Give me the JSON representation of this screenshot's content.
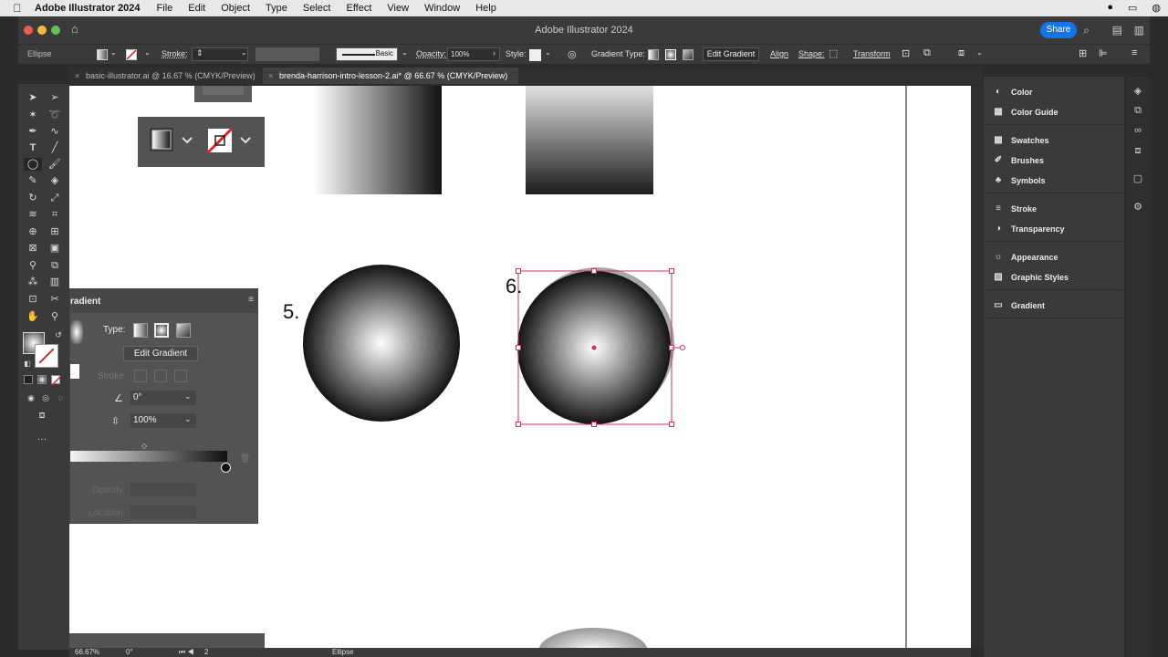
{
  "menubar": {
    "app_name": "Adobe Illustrator 2024",
    "items": [
      "File",
      "Edit",
      "Object",
      "Type",
      "Select",
      "Effect",
      "View",
      "Window",
      "Help"
    ]
  },
  "window": {
    "title": "Adobe Illustrator 2024",
    "share_label": "Share"
  },
  "controlbar": {
    "object_type": "Ellipse",
    "stroke_label": "Stroke:",
    "brush_label": "Basic",
    "opacity_label": "Opacity:",
    "opacity_value": "100%",
    "style_label": "Style:",
    "gradient_type_label": "Gradient Type:",
    "edit_gradient_label": "Edit Gradient",
    "align_label": "Align",
    "shape_label": "Shape:",
    "transform_label": "Transform"
  },
  "tabs": [
    {
      "label": "basic-illustrator.ai @ 16.67 % (CMYK/Preview)"
    },
    {
      "label": "brenda-harrison-intro-lesson-2.ai* @ 66.67 % (CMYK/Preview)"
    }
  ],
  "canvas": {
    "label_5": "5.",
    "label_6": "6."
  },
  "gradient_panel": {
    "title": "radient",
    "type_label": "Type:",
    "edit_gradient_label": "Edit Gradient",
    "stroke_label": "Stroke",
    "angle_value": "0°",
    "aspect_value": "100%",
    "opacity_label": "Opacity",
    "location_label": "Location"
  },
  "panels": {
    "items": [
      {
        "label": "Color",
        "icon": "color-icon"
      },
      {
        "label": "Color Guide",
        "icon": "color-guide-icon"
      },
      {
        "label": "Swatches",
        "icon": "swatches-icon"
      },
      {
        "label": "Brushes",
        "icon": "brushes-icon"
      },
      {
        "label": "Symbols",
        "icon": "symbols-icon"
      },
      {
        "label": "Stroke",
        "icon": "stroke-icon"
      },
      {
        "label": "Transparency",
        "icon": "transparency-icon"
      },
      {
        "label": "Appearance",
        "icon": "appearance-icon"
      },
      {
        "label": "Graphic Styles",
        "icon": "graphic-styles-icon"
      },
      {
        "label": "Gradient",
        "icon": "gradient-icon"
      }
    ]
  },
  "statusbar": {
    "zoom": "66.67%",
    "rotation": "0°",
    "artboard": "2",
    "tool": "Ellipse"
  },
  "colors": {
    "selection": "#d1305a",
    "accent": "#1473e6"
  }
}
